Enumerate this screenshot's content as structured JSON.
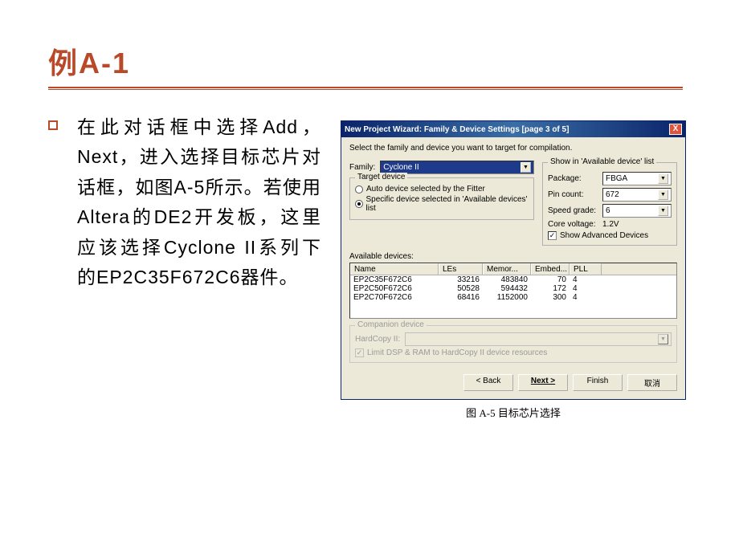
{
  "slide": {
    "title": "例A-1",
    "bullet_text": "在此对话框中选择Add，Next，进入选择目标芯片对话框，如图A-5所示。若使用Altera的DE2开发板，这里应该选择Cyclone II系列下的EP2C35F672C6器件。",
    "caption": "图 A-5 目标芯片选择"
  },
  "dialog": {
    "title": "New Project Wizard: Family & Device Settings [page 3 of 5]",
    "close": "X",
    "instruction": "Select the family and device you want to target for compilation.",
    "family_label": "Family:",
    "family_value": "Cyclone II",
    "target_group": "Target device",
    "radio_auto": "Auto device selected by the Fitter",
    "radio_specific": "Specific device selected in 'Available devices' list",
    "filter_group": "Show in 'Available device' list",
    "filters": {
      "package_label": "Package:",
      "package_value": "FBGA",
      "pin_label": "Pin count:",
      "pin_value": "672",
      "speed_label": "Speed grade:",
      "speed_value": "6",
      "core_label": "Core voltage:",
      "core_value": "1.2V",
      "adv_label": "Show Advanced Devices"
    },
    "available_label": "Available devices:",
    "columns": {
      "name": "Name",
      "les": "LEs",
      "mem": "Memor...",
      "emb": "Embed...",
      "pll": "PLL"
    },
    "devices": [
      {
        "name": "EP2C35F672C6",
        "les": "33216",
        "mem": "483840",
        "emb": "70",
        "pll": "4"
      },
      {
        "name": "EP2C50F672C6",
        "les": "50528",
        "mem": "594432",
        "emb": "172",
        "pll": "4"
      },
      {
        "name": "EP2C70F672C6",
        "les": "68416",
        "mem": "1152000",
        "emb": "300",
        "pll": "4"
      }
    ],
    "companion": {
      "group": "Companion device",
      "hc_label": "HardCopy II:",
      "limit_label": "Limit DSP & RAM to HardCopy II device resources"
    },
    "buttons": {
      "back": "< Back",
      "next": "Next >",
      "finish": "Finish",
      "cancel": "取消"
    }
  }
}
